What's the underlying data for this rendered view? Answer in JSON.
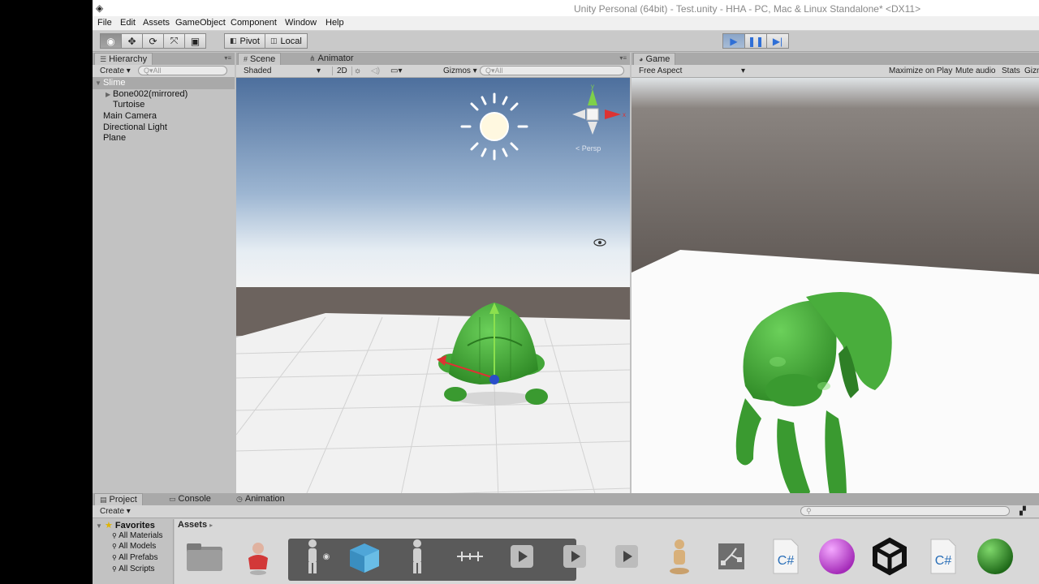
{
  "app": {
    "title": "Unity Personal (64bit) - Test.unity - HHA - PC, Mac & Linux Standalone* <DX11>"
  },
  "menu": [
    "File",
    "Edit",
    "Assets",
    "GameObject",
    "Component",
    "Window",
    "Help"
  ],
  "toolbar": {
    "pivot_label": "Pivot",
    "local_label": "Local"
  },
  "hierarchy": {
    "tab_label": "Hierarchy",
    "create_label": "Create",
    "search_placeholder": "Q▾All",
    "items": [
      {
        "label": "Slime",
        "selected": true
      },
      {
        "label": "Bone002(mirrored)",
        "has_children": true
      },
      {
        "label": "Turtoise"
      },
      {
        "label": "Main Camera"
      },
      {
        "label": "Directional Light"
      },
      {
        "label": "Plane"
      }
    ]
  },
  "scene": {
    "tab_label": "Scene",
    "animator_tab_label": "Animator",
    "shaded_label": "Shaded",
    "mode_2d_label": "2D",
    "gizmos_label": "Gizmos",
    "search_placeholder": "Q▾All",
    "persp_label": "< Persp"
  },
  "game": {
    "tab_label": "Game",
    "aspect_label": "Free Aspect",
    "maximize_label": "Maximize on Play",
    "mute_label": "Mute audio",
    "stats_label": "Stats",
    "gizmos_label": "Gizmos"
  },
  "project": {
    "tab_label": "Project",
    "console_tab_label": "Console",
    "animation_tab_label": "Animation",
    "create_label": "Create",
    "favorites_label": "Favorites",
    "favorites": [
      "All Materials",
      "All Models",
      "All Prefabs",
      "All Scripts"
    ],
    "breadcrumb": "Assets"
  },
  "colors": {
    "selection_blue": "#2f6fd6",
    "turtle_green": "#3c9a2f"
  }
}
